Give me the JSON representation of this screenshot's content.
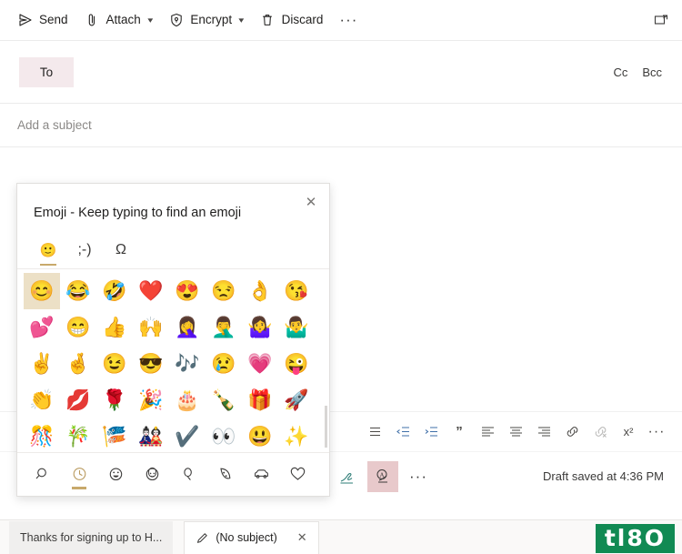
{
  "commandbar": {
    "items": [
      {
        "label": "Send",
        "icon": "send-icon",
        "chevron": false
      },
      {
        "label": "Attach",
        "icon": "paperclip-icon",
        "chevron": true
      },
      {
        "label": "Encrypt",
        "icon": "shield-lock-icon",
        "chevron": true
      },
      {
        "label": "Discard",
        "icon": "trash-icon",
        "chevron": false
      }
    ],
    "overflow_label": "···",
    "popout_icon": "pop-out-icon"
  },
  "header": {
    "to_label": "To",
    "to_value": "",
    "to_placeholder": "",
    "cc_label": "Cc",
    "bcc_label": "Bcc",
    "subject_value": "",
    "subject_placeholder": "Add a subject"
  },
  "emoji_picker": {
    "title": "Emoji - Keep typing to find an emoji",
    "close_icon": "close-icon",
    "close_label": "✕",
    "tabs": [
      {
        "name": "emoji-tab",
        "glyph": "🙂",
        "selected": true
      },
      {
        "name": "emoticon-tab",
        "glyph": ";-)",
        "selected": false
      },
      {
        "name": "symbol-tab",
        "glyph": "Ω",
        "selected": false
      }
    ],
    "selected_accent": "#c8a96b",
    "selected_cell_bg": "#ece0c6",
    "emojis": [
      {
        "glyph": "😊",
        "name": "smiling-face-with-smiling-eyes",
        "selected": true
      },
      {
        "glyph": "😂",
        "name": "face-with-tears-of-joy",
        "selected": false
      },
      {
        "glyph": "🤣",
        "name": "rolling-on-the-floor-laughing",
        "selected": false
      },
      {
        "glyph": "❤️",
        "name": "red-heart",
        "selected": false
      },
      {
        "glyph": "😍",
        "name": "smiling-face-with-heart-eyes",
        "selected": false
      },
      {
        "glyph": "😒",
        "name": "unamused-face",
        "selected": false
      },
      {
        "glyph": "👌",
        "name": "ok-hand",
        "selected": false
      },
      {
        "glyph": "😘",
        "name": "face-blowing-a-kiss",
        "selected": false
      },
      {
        "glyph": "💕",
        "name": "two-hearts",
        "selected": false
      },
      {
        "glyph": "😁",
        "name": "beaming-face-with-smiling-eyes",
        "selected": false
      },
      {
        "glyph": "👍",
        "name": "thumbs-up",
        "selected": false
      },
      {
        "glyph": "🙌",
        "name": "raising-hands",
        "selected": false
      },
      {
        "glyph": "🤦‍♀️",
        "name": "woman-facepalming",
        "selected": false
      },
      {
        "glyph": "🤦‍♂️",
        "name": "man-facepalming",
        "selected": false
      },
      {
        "glyph": "🤷‍♀️",
        "name": "woman-shrugging",
        "selected": false
      },
      {
        "glyph": "🤷‍♂️",
        "name": "man-shrugging",
        "selected": false
      },
      {
        "glyph": "✌️",
        "name": "victory-hand",
        "selected": false
      },
      {
        "glyph": "🤞",
        "name": "crossed-fingers",
        "selected": false
      },
      {
        "glyph": "😉",
        "name": "winking-face",
        "selected": false
      },
      {
        "glyph": "😎",
        "name": "smiling-face-with-sunglasses",
        "selected": false
      },
      {
        "glyph": "🎶",
        "name": "musical-notes",
        "selected": false
      },
      {
        "glyph": "😢",
        "name": "crying-face",
        "selected": false
      },
      {
        "glyph": "💗",
        "name": "growing-heart",
        "selected": false
      },
      {
        "glyph": "😜",
        "name": "winking-face-with-tongue",
        "selected": false
      },
      {
        "glyph": "👏",
        "name": "clapping-hands",
        "selected": false
      },
      {
        "glyph": "💋",
        "name": "kiss-mark",
        "selected": false
      },
      {
        "glyph": "🌹",
        "name": "rose",
        "selected": false
      },
      {
        "glyph": "🎉",
        "name": "party-popper",
        "selected": false
      },
      {
        "glyph": "🎂",
        "name": "birthday-cake",
        "selected": false
      },
      {
        "glyph": "🍾",
        "name": "bottle-with-popping-cork",
        "selected": false
      },
      {
        "glyph": "🎁",
        "name": "wrapped-gift",
        "selected": false
      },
      {
        "glyph": "🚀",
        "name": "rocket",
        "selected": false
      },
      {
        "glyph": "🎊",
        "name": "confetti-ball",
        "selected": false
      },
      {
        "glyph": "🎋",
        "name": "tanabata-tree",
        "selected": false
      },
      {
        "glyph": "🎏",
        "name": "carp-streamer",
        "selected": false
      },
      {
        "glyph": "🎎",
        "name": "pine-decoration",
        "selected": false
      },
      {
        "glyph": "✔️",
        "name": "check-mark",
        "selected": false
      },
      {
        "glyph": "👀",
        "name": "eyes",
        "selected": false
      },
      {
        "glyph": "😃",
        "name": "grinning-face-with-big-eyes",
        "selected": false
      },
      {
        "glyph": "✨",
        "name": "sparkles",
        "selected": false
      }
    ],
    "categories": [
      {
        "icon": "search-icon",
        "name": "search",
        "selected": false
      },
      {
        "icon": "clock-icon",
        "name": "recently-used",
        "selected": true
      },
      {
        "icon": "smiley-icon",
        "name": "smileys",
        "selected": false
      },
      {
        "icon": "person-icon",
        "name": "people",
        "selected": false
      },
      {
        "icon": "balloon-icon",
        "name": "celebration",
        "selected": false
      },
      {
        "icon": "pizza-icon",
        "name": "food",
        "selected": false
      },
      {
        "icon": "car-icon",
        "name": "travel",
        "selected": false
      },
      {
        "icon": "heart-icon",
        "name": "symbols",
        "selected": false
      }
    ]
  },
  "format_toolbar": {
    "items": [
      {
        "name": "bullet-list-icon",
        "glyph": "list",
        "dim": false
      },
      {
        "name": "decrease-indent-icon",
        "glyph": "outdent",
        "dim": false
      },
      {
        "name": "increase-indent-icon",
        "glyph": "indent",
        "dim": false
      },
      {
        "name": "quote-icon",
        "glyph": "”",
        "dim": false
      },
      {
        "name": "align-left-icon",
        "glyph": "align-left",
        "dim": false
      },
      {
        "name": "align-center-icon",
        "glyph": "align-center",
        "dim": false
      },
      {
        "name": "align-right-icon",
        "glyph": "align-right",
        "dim": false
      },
      {
        "name": "insert-link-icon",
        "glyph": "link",
        "dim": false
      },
      {
        "name": "remove-link-icon",
        "glyph": "unlink",
        "dim": true
      },
      {
        "name": "superscript-icon",
        "glyph": "x²",
        "dim": false
      },
      {
        "name": "more-formatting-icon",
        "glyph": "···",
        "dim": false
      }
    ]
  },
  "action_bar": {
    "items": [
      {
        "name": "signature-icon",
        "highlight": false
      },
      {
        "name": "formatting-options-icon",
        "highlight": true
      },
      {
        "name": "more-actions-icon",
        "highlight": false
      }
    ],
    "status": "Draft saved at 4:36 PM"
  },
  "taskbar": {
    "tabs": [
      {
        "label": "Thanks for signing up to H...",
        "active": false,
        "pencil": false,
        "close": false
      },
      {
        "label": "(No subject)",
        "active": true,
        "pencil": true,
        "close": true,
        "close_glyph": "✕"
      }
    ]
  },
  "watermark": {
    "text": "tl8O",
    "color": "#118a53"
  }
}
